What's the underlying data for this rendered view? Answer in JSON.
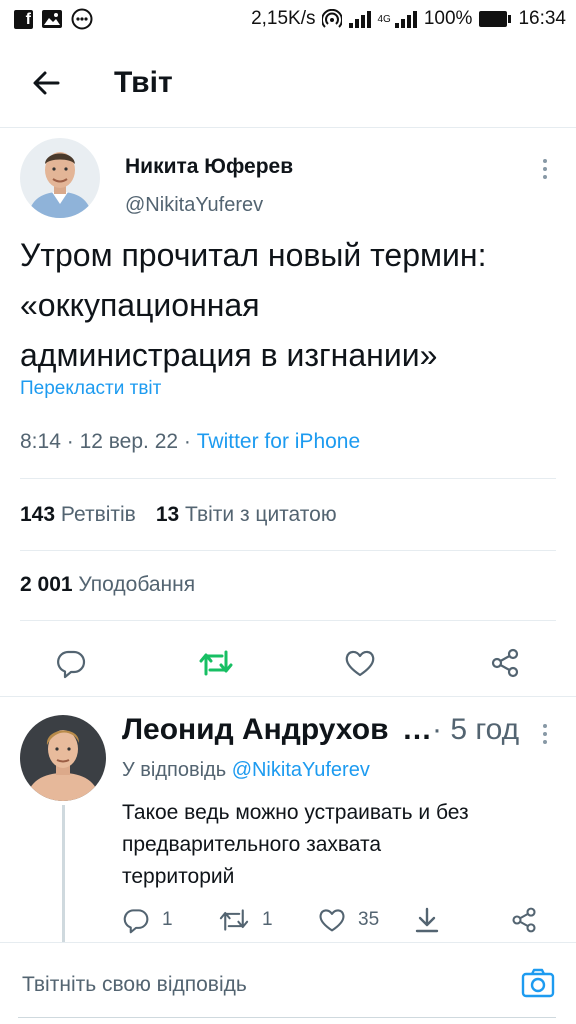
{
  "status_bar": {
    "network_speed": "2,15K/s",
    "network_type": "4G",
    "battery": "100%",
    "time": "16:34",
    "icons": [
      "facebook-icon",
      "image-icon",
      "more-icon",
      "hotspot-icon",
      "signal-icon",
      "battery-icon"
    ]
  },
  "header": {
    "title": "Твіт",
    "back_icon": "arrow-left-icon"
  },
  "tweet": {
    "author_name": "Никита Юферев",
    "author_handle": "@NikitaYuferev",
    "text": "Утром прочитал новый термин:\n«оккупационная\nадминистрация в изгнании»",
    "translate_label": "Перекласти твіт",
    "time": "8:14",
    "date": "12 вер. 22",
    "separator": "·",
    "source": "Twitter for iPhone",
    "retweets_count": "143",
    "retweets_label": "Ретвітів",
    "quotes_count": "13",
    "quotes_label": "Твіти з цитатою",
    "likes_count": "2 001",
    "likes_label": "Уподобання"
  },
  "reply": {
    "author_name": "Леонид Андрухов",
    "ellipsis": "…",
    "time": "· 5 год",
    "reply_to_prefix": "У відповідь",
    "reply_to_handle": "@NikitaYuferev",
    "text": "Такое ведь можно устраивать и без\nпредварительного захвата\nтерриторий",
    "reply_count": "1",
    "retweet_count": "1",
    "like_count": "35"
  },
  "compose": {
    "placeholder": "Твітніть свою відповідь"
  },
  "colors": {
    "accent": "#1d9bf0",
    "retweet_green": "#17bf63",
    "text_primary": "#0f1419",
    "text_secondary": "#536471"
  }
}
